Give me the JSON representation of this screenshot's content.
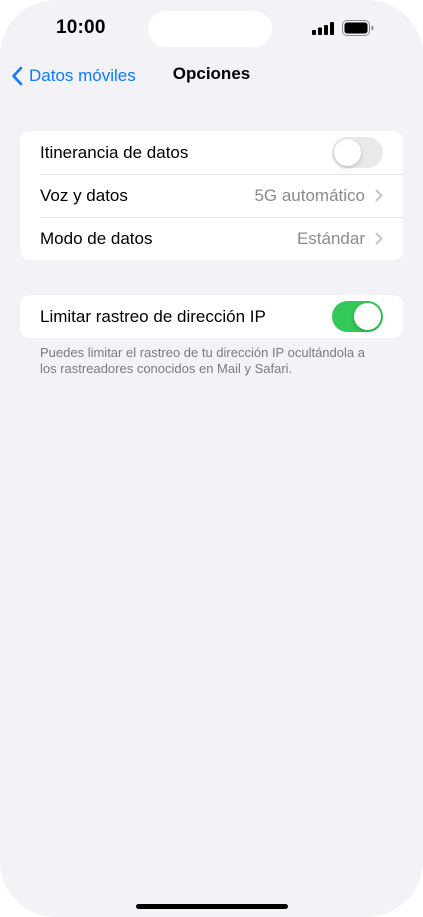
{
  "status_bar": {
    "time": "10:00"
  },
  "nav": {
    "back_label": "Datos móviles",
    "title": "Opciones"
  },
  "group1": {
    "roaming": {
      "label": "Itinerancia de datos",
      "enabled": false
    },
    "voice_data": {
      "label": "Voz y datos",
      "value": "5G automático"
    },
    "data_mode": {
      "label": "Modo de datos",
      "value": "Estándar"
    }
  },
  "group2": {
    "ip_tracking": {
      "label": "Limitar rastreo de dirección IP",
      "enabled": true
    },
    "footnote": "Puedes limitar el rastreo de tu dirección IP ocultándola a los rastreadores conocidos en Mail y Safari."
  },
  "colors": {
    "accent": "#0a7aff",
    "toggle_on": "#34c759",
    "background": "#f2f2f7"
  }
}
